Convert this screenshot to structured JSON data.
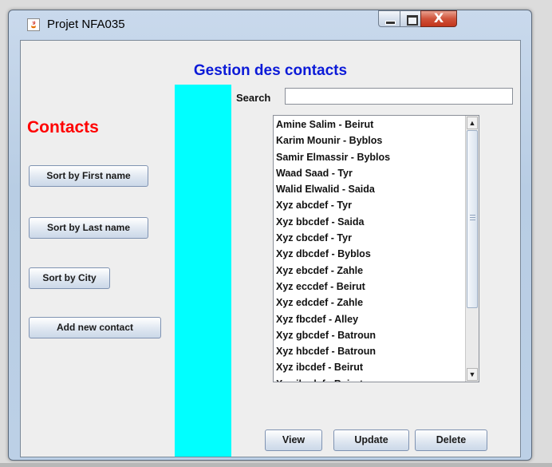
{
  "window": {
    "title": "Projet NFA035",
    "close_glyph": "X"
  },
  "heading": "Gestion des contacts",
  "contacts_label": "Contacts",
  "sidebar": {
    "sort_first_name": "Sort by First name",
    "sort_last_name": "Sort by Last name",
    "sort_city": "Sort by City",
    "add_new_contact": "Add new contact"
  },
  "search": {
    "label": "Search",
    "value": ""
  },
  "contacts": [
    "Amine Salim - Beirut",
    "Karim Mounir - Byblos",
    "Samir Elmassir - Byblos",
    "Waad Saad - Tyr",
    "Walid Elwalid - Saida",
    "Xyz abcdef - Tyr",
    "Xyz bbcdef - Saida",
    "Xyz cbcdef - Tyr",
    "Xyz dbcdef - Byblos",
    "Xyz ebcdef - Zahle",
    "Xyz eccdef - Beirut",
    "Xyz edcdef - Zahle",
    "Xyz fbcdef - Alley",
    "Xyz gbcdef - Batroun",
    "Xyz hbcdef - Batroun",
    "Xyz ibcdef - Beirut",
    "Xyz jbcdef - Beirut"
  ],
  "actions": {
    "view": "View",
    "update": "Update",
    "delete": "Delete"
  },
  "colors": {
    "heading": "#0b1ad8",
    "contacts_label": "#ff0000",
    "divider_bar": "#00ffff"
  }
}
